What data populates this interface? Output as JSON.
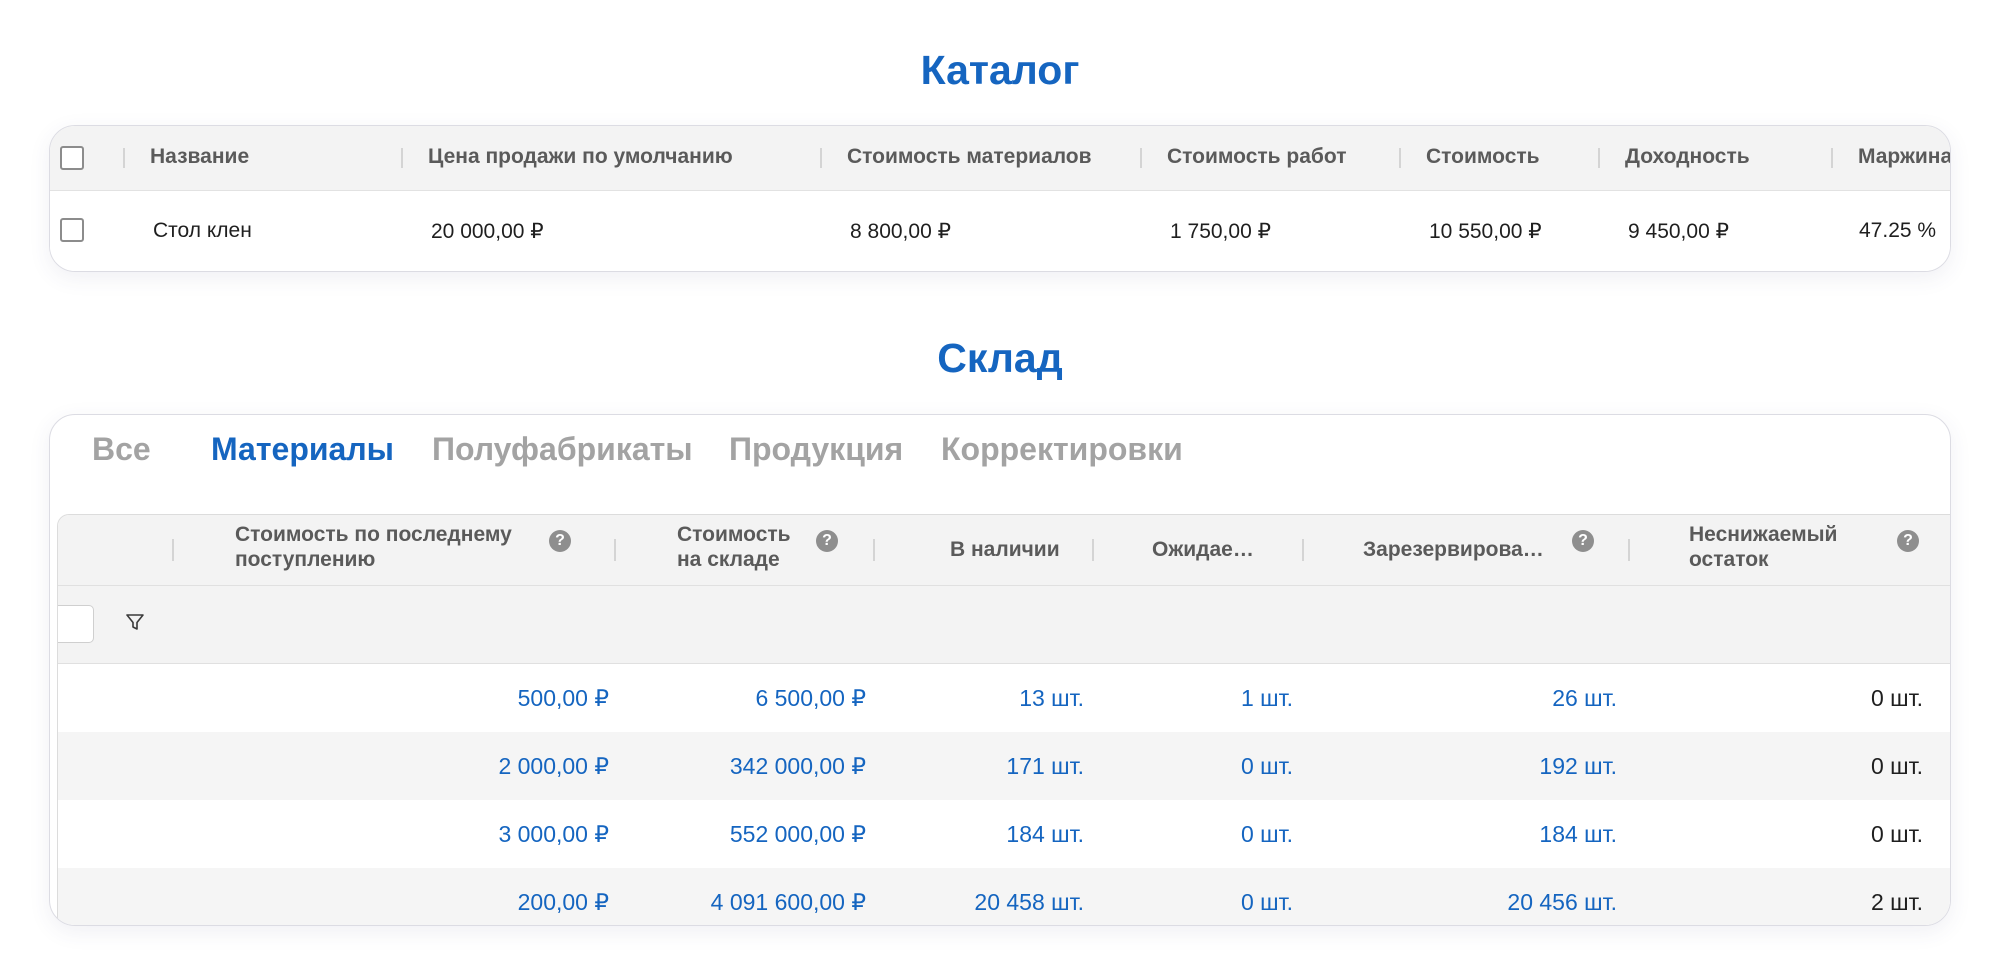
{
  "catalog": {
    "title": "Каталог",
    "headers": [
      "Название",
      "Цена продажи по умолчанию",
      "Стоимость материалов",
      "Стоимость работ",
      "Стоимость",
      "Доходность",
      "Маржина"
    ],
    "rows": [
      [
        "Стол клен",
        "20 000,00 ₽",
        "8 800,00 ₽",
        "1 750,00 ₽",
        "10 550,00 ₽",
        "9 450,00 ₽",
        "47.25 %"
      ]
    ]
  },
  "warehouse": {
    "title": "Склад",
    "tabs": [
      {
        "label": "Все",
        "active": false
      },
      {
        "label": "Материалы",
        "active": true
      },
      {
        "label": "Полуфабрикаты",
        "active": false
      },
      {
        "label": "Продукция",
        "active": false
      },
      {
        "label": "Корректировки",
        "active": false
      }
    ],
    "columns": [
      {
        "line1": "Стоимость по последнему",
        "line2": "поступлению",
        "help": true
      },
      {
        "line1": "Стоимость",
        "line2": "на складе",
        "help": true
      },
      {
        "line1": "В наличии",
        "line2": "",
        "help": false
      },
      {
        "line1": "Ожидае…",
        "line2": "",
        "help": false
      },
      {
        "line1": "Зарезервирова…",
        "line2": "",
        "help": true
      },
      {
        "line1": "Неснижаемый",
        "line2": "остаток",
        "help": true
      }
    ],
    "help_glyph": "?",
    "rows": [
      [
        "500,00 ₽",
        "6 500,00 ₽",
        "13 шт.",
        "1 шт.",
        "26 шт.",
        "0 шт."
      ],
      [
        "2 000,00 ₽",
        "342 000,00 ₽",
        "171 шт.",
        "0 шт.",
        "192 шт.",
        "0 шт."
      ],
      [
        "3 000,00 ₽",
        "552 000,00 ₽",
        "184 шт.",
        "0 шт.",
        "184 шт.",
        "0 шт."
      ],
      [
        "200,00 ₽",
        "4 091 600,00 ₽",
        "20 458 шт.",
        "0 шт.",
        "20 456 шт.",
        "2 шт."
      ]
    ]
  },
  "colors": {
    "accent": "#1565c0",
    "tab_inactive": "#a3a3a3",
    "header_bg": "#f3f3f3"
  },
  "icons": [
    "checkbox-icon",
    "filter-icon",
    "help-icon"
  ]
}
